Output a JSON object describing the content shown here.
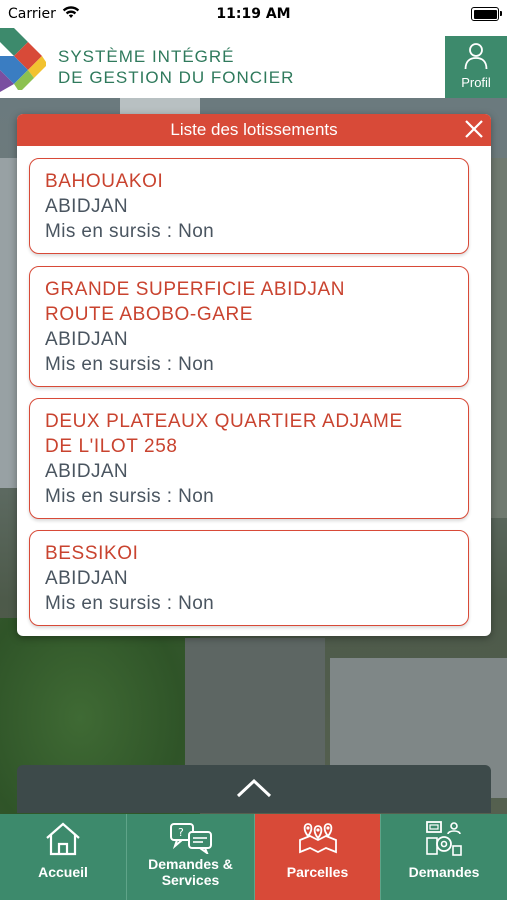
{
  "status_bar": {
    "carrier": "Carrier",
    "time": "11:19 AM"
  },
  "header": {
    "title_line1": "SYSTÈME INTÉGRÉ",
    "title_line2": "DE GESTION DU FONCIER",
    "profil_label": "Profil",
    "logo_icon": "sigfu-logo-icon"
  },
  "modal": {
    "title": "Liste des lotissements",
    "items": [
      {
        "name_lines": [
          "BAHOUAKOI"
        ],
        "city": "ABIDJAN",
        "status": "Mis en sursis : Non"
      },
      {
        "name_lines": [
          "GRANDE SUPERFICIE ABIDJAN",
          "ROUTE ABOBO-GARE"
        ],
        "city": "ABIDJAN",
        "status": "Mis en sursis : Non"
      },
      {
        "name_lines": [
          "DEUX PLATEAUX QUARTIER ADJAME",
          "DE L'ILOT 258"
        ],
        "city": "ABIDJAN",
        "status": "Mis en sursis : Non"
      },
      {
        "name_lines": [
          "BESSIKOI"
        ],
        "city": "ABIDJAN",
        "status": "Mis en sursis : Non"
      }
    ]
  },
  "tabs": [
    {
      "label_lines": [
        "Accueil"
      ],
      "icon": "home-icon"
    },
    {
      "label_lines": [
        "Demandes &",
        "Services"
      ],
      "icon": "chat-question-icon"
    },
    {
      "label_lines": [
        "Parcelles"
      ],
      "icon": "map-pins-icon",
      "active": true
    },
    {
      "label_lines": [
        "Demandes"
      ],
      "icon": "documents-gear-icon"
    }
  ],
  "colors": {
    "brand_green": "#3d8a6c",
    "accent_red": "#d84a38",
    "text_gray": "#4a5560"
  }
}
